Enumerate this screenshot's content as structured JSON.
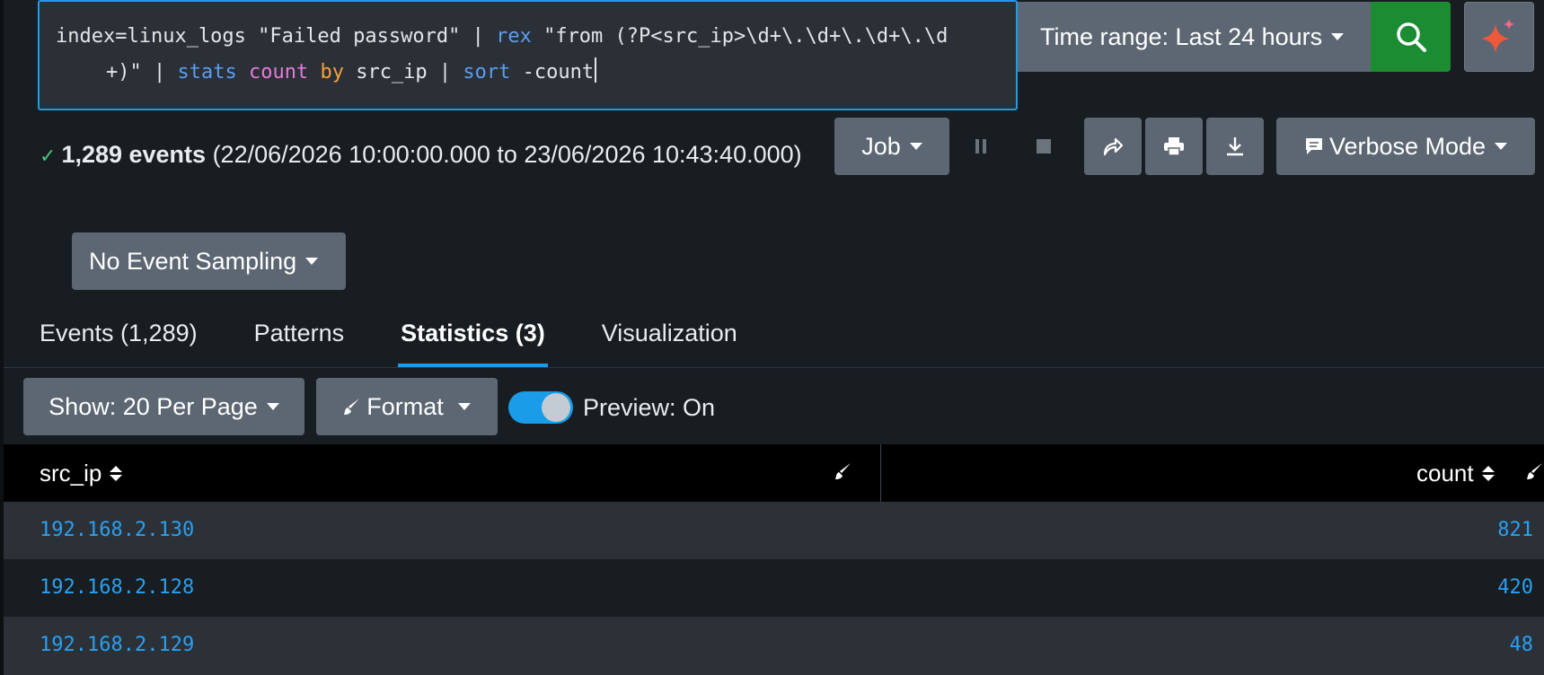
{
  "search": {
    "line1_prefix": "index=linux_logs \"Failed password\" | ",
    "line1_rex": "rex",
    "line1_rest": " \"from (?P<src_ip>\\d+\\.\\d+\\.\\d+\\.\\d",
    "line2_start": "+)\" | ",
    "line2_stats": "stats",
    "line2_space1": " ",
    "line2_count": "count",
    "line2_space2": " ",
    "line2_by": "by",
    "line2_mid": " src_ip | ",
    "line2_sort": "sort",
    "line2_end": " -count"
  },
  "time_range": {
    "label": "Time range: Last 24 hours"
  },
  "status": {
    "check": "✓",
    "events_bold": "1,289 events",
    "range": " (22/06/2026 10:00:00.000 to 23/06/2026 10:43:40.000)"
  },
  "toolbar": {
    "job_label": "Job",
    "mode_label": "Verbose Mode",
    "sampling_label": "No Event Sampling"
  },
  "tabs": [
    {
      "label": "Events (1,289)"
    },
    {
      "label": "Patterns"
    },
    {
      "label": "Statistics (3)"
    },
    {
      "label": "Visualization"
    }
  ],
  "options": {
    "show_label": "Show: 20 Per Page",
    "format_label": "Format",
    "preview_label": "Preview: On"
  },
  "table": {
    "columns": [
      "src_ip",
      "count"
    ],
    "rows": [
      {
        "src_ip": "192.168.2.130",
        "count": "821"
      },
      {
        "src_ip": "192.168.2.128",
        "count": "420"
      },
      {
        "src_ip": "192.168.2.129",
        "count": "48"
      }
    ]
  },
  "colors": {
    "accent": "#1a9ce8",
    "search_button": "#1c8c32",
    "link": "#2b9ff0",
    "success": "#4bc37a"
  },
  "icons": {
    "search": "search-icon",
    "ai": "sparkle-icon",
    "pause": "pause-icon",
    "stop": "stop-icon",
    "share": "share-icon",
    "print": "print-icon",
    "export": "download-icon",
    "mode": "comment-icon",
    "brush": "brush-icon"
  }
}
